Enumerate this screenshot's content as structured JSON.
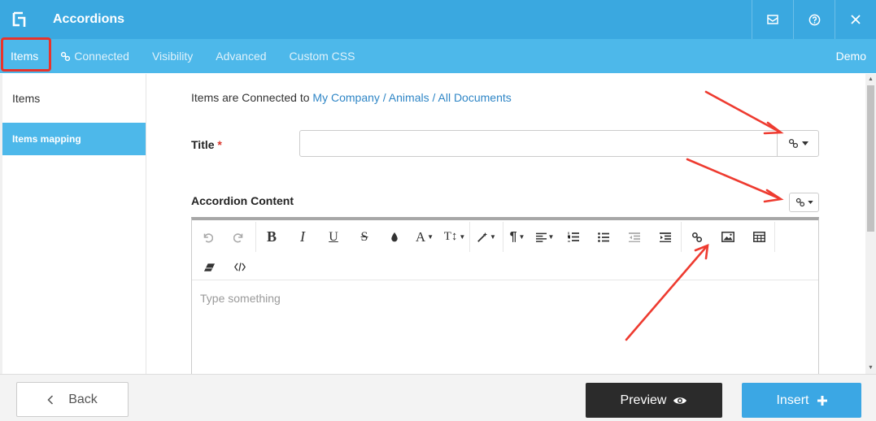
{
  "header": {
    "title": "Accordions"
  },
  "tabs": [
    {
      "label": "Items"
    },
    {
      "label": "Connected"
    },
    {
      "label": "Visibility"
    },
    {
      "label": "Advanced"
    },
    {
      "label": "Custom CSS"
    }
  ],
  "tab_right": "Demo",
  "sidebar": {
    "items": [
      {
        "label": "Items"
      },
      {
        "label": "Items mapping"
      }
    ]
  },
  "main": {
    "connected_prefix": "Items are Connected to",
    "breadcrumb": [
      "My Company",
      "Animals",
      "All Documents"
    ],
    "separator": "/",
    "title_label": "Title",
    "required_mark": "*",
    "content_label": "Accordion Content",
    "editor_placeholder": "Type something",
    "title_value": ""
  },
  "toolbar": {
    "bold": "B",
    "italic": "I",
    "underline": "U",
    "strike": "S",
    "font_size": "A",
    "text_height": "T↕",
    "paragraph": "¶"
  },
  "footer": {
    "back_label": "Back",
    "preview_label": "Preview",
    "insert_label": "Insert"
  },
  "colors": {
    "header": "#3aa8e0",
    "tabbar": "#4db8ea",
    "highlight": "#e8332b",
    "arrow": "#ee3b30",
    "link": "#2f86c6",
    "insert": "#3ba7e4",
    "preview": "#2b2b2b"
  }
}
